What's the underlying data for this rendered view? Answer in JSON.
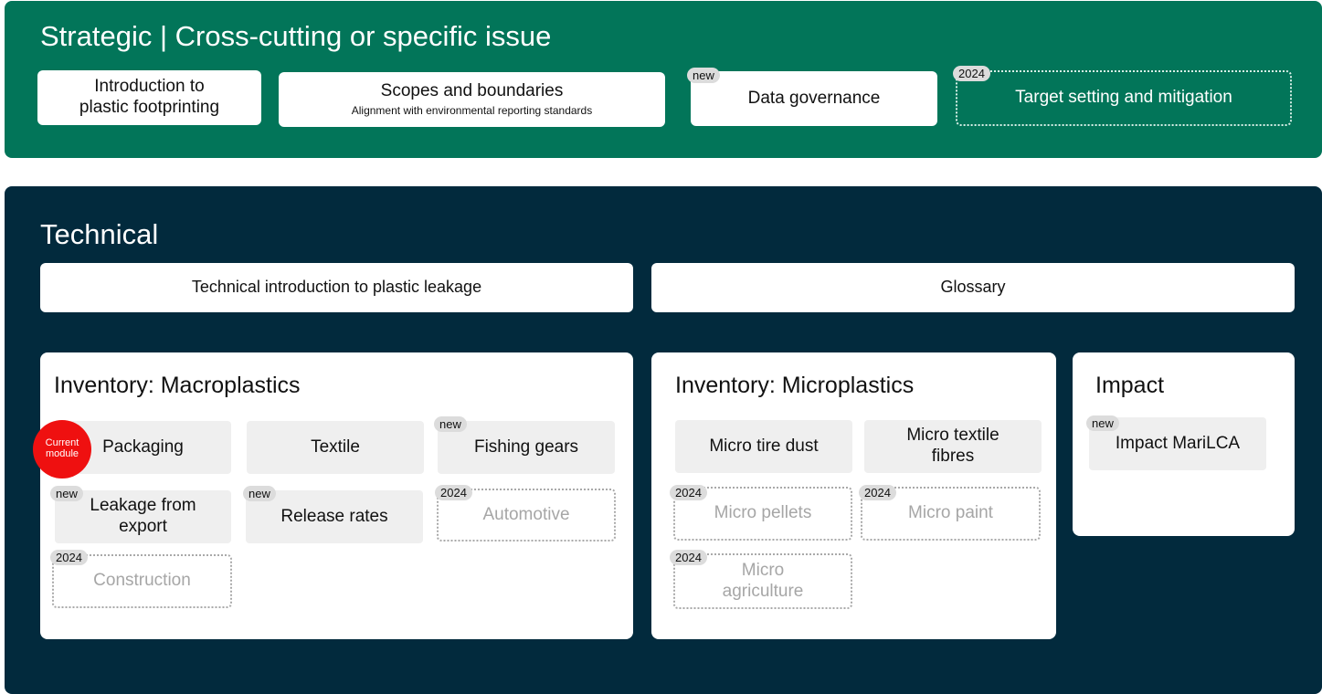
{
  "strategic": {
    "title": "Strategic | Cross-cutting or specific issue",
    "modules": [
      {
        "lines": [
          "Introduction to",
          "plastic footprinting"
        ]
      },
      {
        "title": "Scopes and boundaries",
        "subtitle": "Alignment with environmental reporting standards"
      },
      {
        "title": "Data governance",
        "tag": "new"
      },
      {
        "title": "Target setting and mitigation",
        "tag": "2024"
      }
    ]
  },
  "technical": {
    "title": "Technical",
    "intro": "Technical introduction to plastic leakage",
    "glossary": "Glossary",
    "macro": {
      "title": "Inventory: Macroplastics",
      "current_badge": [
        "Current",
        "module"
      ],
      "items": [
        {
          "label": "Packaging"
        },
        {
          "label": "Textile"
        },
        {
          "label": "Fishing gears",
          "tag": "new"
        },
        {
          "lines": [
            "Leakage from",
            "export"
          ],
          "tag": "new"
        },
        {
          "label": "Release rates",
          "tag": "new"
        },
        {
          "label": "Automotive",
          "tag": "2024"
        },
        {
          "label": "Construction",
          "tag": "2024"
        }
      ]
    },
    "micro": {
      "title": "Inventory: Microplastics",
      "items": [
        {
          "label": "Micro tire dust"
        },
        {
          "lines": [
            "Micro textile",
            "fibres"
          ]
        },
        {
          "label": "Micro pellets",
          "tag": "2024"
        },
        {
          "label": "Micro paint",
          "tag": "2024"
        },
        {
          "lines": [
            "Micro",
            "agriculture"
          ],
          "tag": "2024"
        }
      ]
    },
    "impact": {
      "title": "Impact",
      "items": [
        {
          "label": "Impact MariLCA",
          "tag": "new"
        }
      ]
    }
  }
}
